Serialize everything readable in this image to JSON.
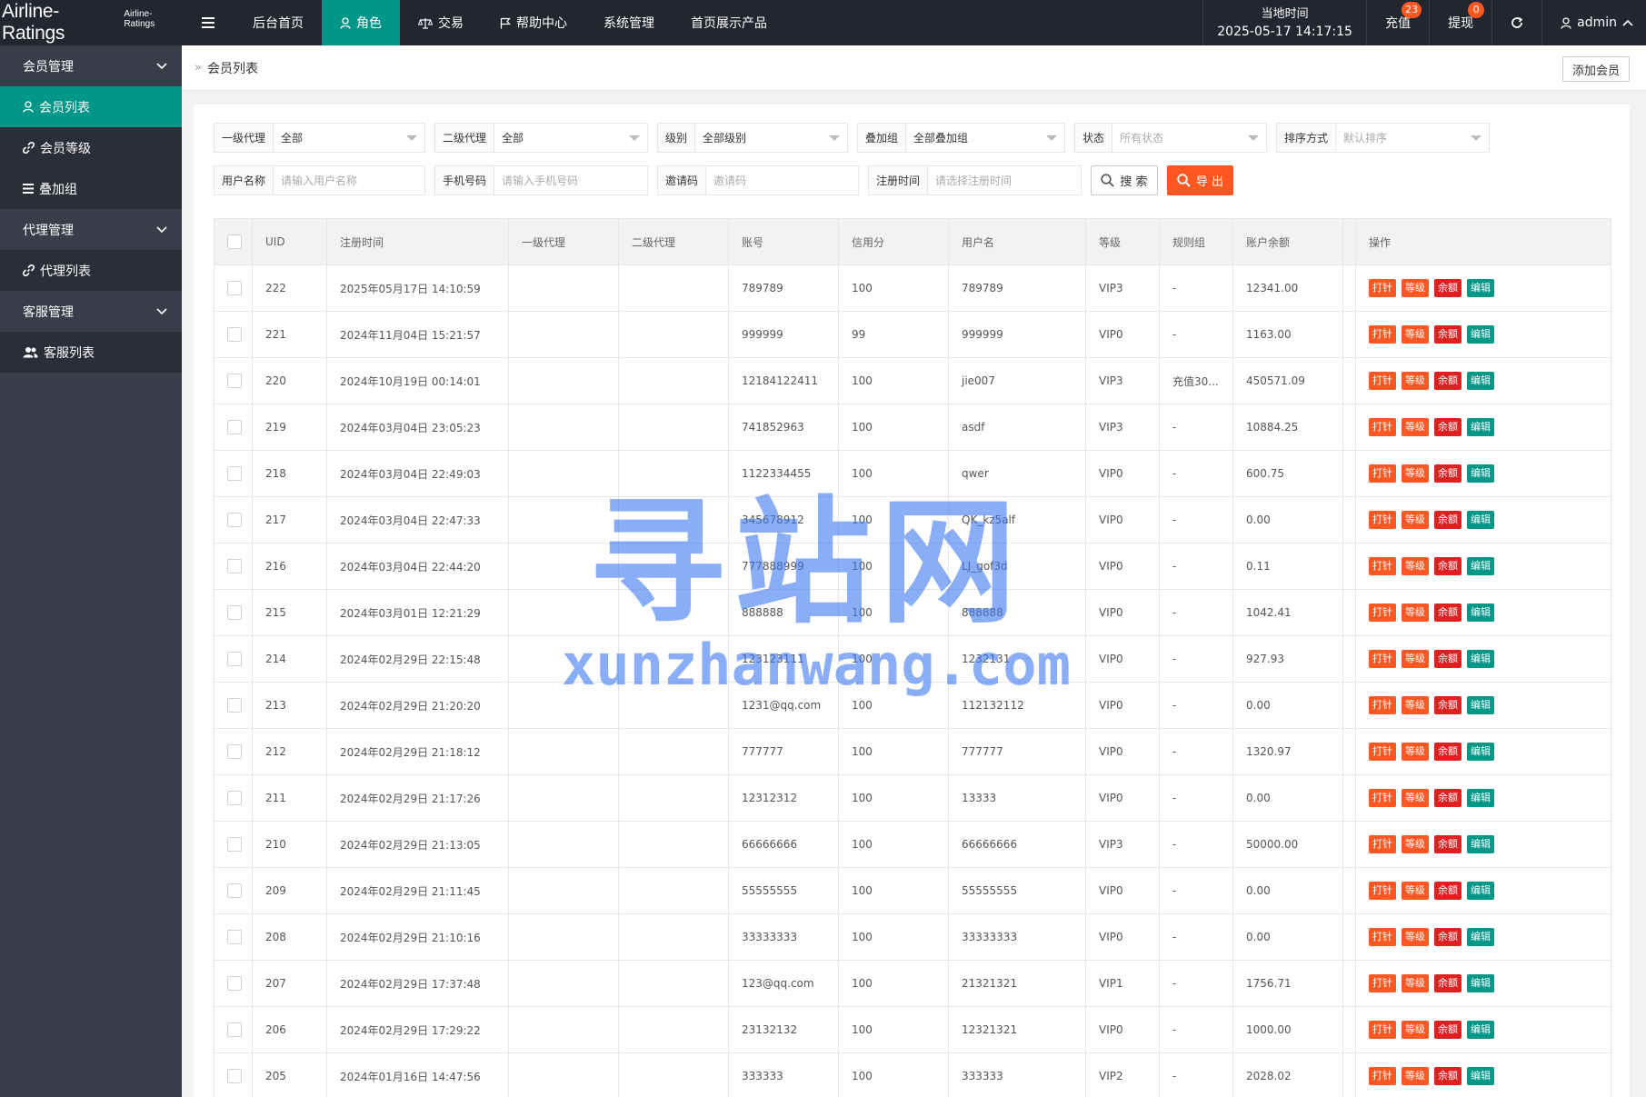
{
  "brand": {
    "name": "Airline-Ratings",
    "sub": "Airline-Ratings"
  },
  "topnav": [
    {
      "label": "后台首页",
      "icon": ""
    },
    {
      "label": "角色",
      "icon": "user-icon"
    },
    {
      "label": "交易",
      "icon": "scale-icon"
    },
    {
      "label": "帮助中心",
      "icon": "flag-icon"
    },
    {
      "label": "系统管理",
      "icon": ""
    },
    {
      "label": "首页展示产品",
      "icon": ""
    }
  ],
  "topright": {
    "time_label": "当地时间",
    "time_value": "2025-05-17 14:17:15",
    "recharge_label": "充值",
    "recharge_badge": "23",
    "withdraw_label": "提现",
    "withdraw_badge": "0",
    "user_label": "admin"
  },
  "sidebar": {
    "group_member": "会员管理",
    "item_member_list": "会员列表",
    "item_member_level": "会员等级",
    "item_stack_group": "叠加组",
    "group_agent": "代理管理",
    "item_agent_list": "代理列表",
    "group_service": "客服管理",
    "item_service_list": "客服列表"
  },
  "breadcrumb": {
    "sep": "»",
    "current": "会员列表"
  },
  "add_button": "添加会员",
  "filters": {
    "agent1": {
      "label": "一级代理",
      "value": "全部"
    },
    "agent2": {
      "label": "二级代理",
      "value": "全部"
    },
    "level": {
      "label": "级别",
      "value": "全部级别"
    },
    "stack": {
      "label": "叠加组",
      "value": "全部叠加组"
    },
    "status": {
      "label": "状态",
      "placeholder": "所有状态"
    },
    "sort": {
      "label": "排序方式",
      "placeholder": "默认排序"
    },
    "username": {
      "label": "用户名称",
      "placeholder": "请输入用户名称"
    },
    "phone": {
      "label": "手机号码",
      "placeholder": "请输入手机号码"
    },
    "invite": {
      "label": "邀请码",
      "placeholder": "邀请码"
    },
    "regtime": {
      "label": "注册时间",
      "placeholder": "请选择注册时间"
    },
    "search_label": "搜 索",
    "export_label": "导 出"
  },
  "table": {
    "headers": [
      "UID",
      "注册时间",
      "一级代理",
      "二级代理",
      "账号",
      "信用分",
      "用户名",
      "等级",
      "规则组",
      "账户余额",
      "操作"
    ],
    "actions": [
      "打针",
      "等级",
      "余额",
      "编辑"
    ],
    "rows": [
      [
        "222",
        "2025年05月17日 14:10:59",
        "",
        "",
        "789789",
        "100",
        "789789",
        "VIP3",
        "-",
        "12341.00"
      ],
      [
        "221",
        "2024年11月04日 15:21:57",
        "",
        "",
        "999999",
        "99",
        "999999",
        "VIP0",
        "-",
        "1163.00"
      ],
      [
        "220",
        "2024年10月19日 00:14:01",
        "",
        "",
        "12184122411",
        "100",
        "jie007",
        "VIP3",
        "充值30...",
        "450571.09"
      ],
      [
        "219",
        "2024年03月04日 23:05:23",
        "",
        "",
        "741852963",
        "100",
        "asdf",
        "VIP3",
        "-",
        "10884.25"
      ],
      [
        "218",
        "2024年03月04日 22:49:03",
        "",
        "",
        "1122334455",
        "100",
        "qwer",
        "VIP0",
        "-",
        "600.75"
      ],
      [
        "217",
        "2024年03月04日 22:47:33",
        "",
        "",
        "345678912",
        "100",
        "QK_kz5alf",
        "VIP0",
        "-",
        "0.00"
      ],
      [
        "216",
        "2024年03月04日 22:44:20",
        "",
        "",
        "777888999",
        "100",
        "LJ_gof3d",
        "VIP0",
        "-",
        "0.11"
      ],
      [
        "215",
        "2024年03月01日 12:21:29",
        "",
        "",
        "888888",
        "100",
        "888888",
        "VIP0",
        "-",
        "1042.41"
      ],
      [
        "214",
        "2024年02月29日 22:15:48",
        "",
        "",
        "123123111",
        "100",
        "1232131",
        "VIP0",
        "-",
        "927.93"
      ],
      [
        "213",
        "2024年02月29日 21:20:20",
        "",
        "",
        "1231@qq.com",
        "100",
        "112132112",
        "VIP0",
        "-",
        "0.00"
      ],
      [
        "212",
        "2024年02月29日 21:18:12",
        "",
        "",
        "777777",
        "100",
        "777777",
        "VIP0",
        "-",
        "1320.97"
      ],
      [
        "211",
        "2024年02月29日 21:17:26",
        "",
        "",
        "12312312",
        "100",
        "13333",
        "VIP0",
        "-",
        "0.00"
      ],
      [
        "210",
        "2024年02月29日 21:13:05",
        "",
        "",
        "66666666",
        "100",
        "66666666",
        "VIP3",
        "-",
        "50000.00"
      ],
      [
        "209",
        "2024年02月29日 21:11:45",
        "",
        "",
        "55555555",
        "100",
        "55555555",
        "VIP0",
        "-",
        "0.00"
      ],
      [
        "208",
        "2024年02月29日 21:10:16",
        "",
        "",
        "33333333",
        "100",
        "33333333",
        "VIP0",
        "-",
        "0.00"
      ],
      [
        "207",
        "2024年02月29日 17:37:48",
        "",
        "",
        "123@qq.com",
        "100",
        "21321321",
        "VIP1",
        "-",
        "1756.71"
      ],
      [
        "206",
        "2024年02月29日 17:29:22",
        "",
        "",
        "23132132",
        "100",
        "12321321",
        "VIP0",
        "-",
        "1000.00"
      ],
      [
        "205",
        "2024年01月16日 14:47:56",
        "",
        "",
        "333333",
        "100",
        "333333",
        "VIP2",
        "-",
        "2028.02"
      ]
    ]
  },
  "watermark": {
    "main": "寻站网",
    "sub": "xunzhanwang.com"
  },
  "colors": {
    "accent": "#009688",
    "danger": "#ff5722",
    "red": "#e02020",
    "topbar": "#23262e",
    "sidebar": "#393d49"
  }
}
